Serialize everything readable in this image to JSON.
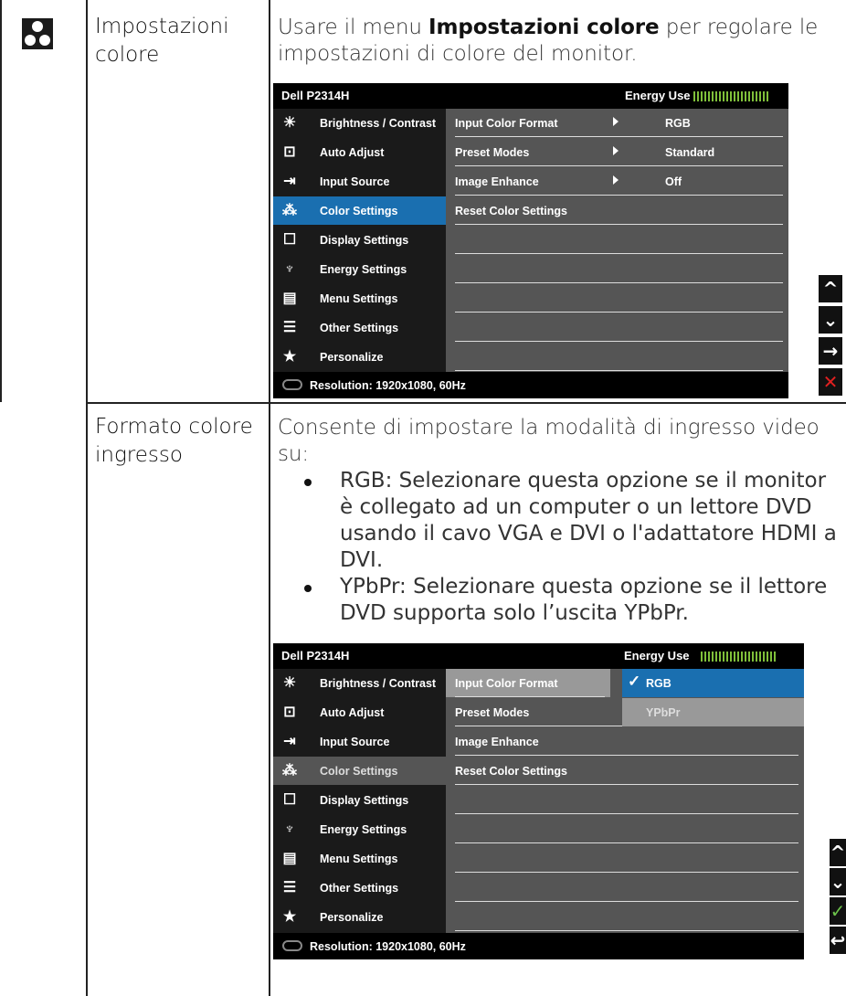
{
  "row1": {
    "title": "Impostazioni colore",
    "desc_pre": "Usare il menu ",
    "desc_bold": "Impostazioni colore",
    "desc_post": " per regolare le impostazioni di colore del monitor."
  },
  "row2": {
    "title": "Formato colore ingresso",
    "intro": "Consente di impostare la modalità di ingresso video su:",
    "bullets": [
      "RGB: Selezionare questa opzione se il monitor è collegato ad un computer o un lettore DVD usando il cavo VGA e DVI o l'adattatore HDMI a DVI.",
      "YPbPr: Selezionare questa opzione se il lettore DVD supporta solo l’uscita YPbPr."
    ]
  },
  "osd": {
    "model": "Dell P2314H",
    "energy_label": "Energy Use",
    "resolution": "Resolution: 1920x1080, 60Hz",
    "menu": [
      {
        "label": "Brightness / Contrast",
        "icon": "brightness-icon"
      },
      {
        "label": "Auto Adjust",
        "icon": "auto-adjust-icon"
      },
      {
        "label": "Input Source",
        "icon": "input-source-icon"
      },
      {
        "label": "Color Settings",
        "icon": "color-settings-icon"
      },
      {
        "label": "Display Settings",
        "icon": "display-settings-icon"
      },
      {
        "label": "Energy Settings",
        "icon": "energy-settings-icon"
      },
      {
        "label": "Menu Settings",
        "icon": "menu-settings-icon"
      },
      {
        "label": "Other Settings",
        "icon": "other-settings-icon"
      },
      {
        "label": "Personalize",
        "icon": "star-icon"
      }
    ],
    "submenu": [
      {
        "label": "Input Color Format",
        "value": "RGB"
      },
      {
        "label": "Preset Modes",
        "value": "Standard"
      },
      {
        "label": "Image Enhance",
        "value": "Off"
      },
      {
        "label": "Reset Color Settings",
        "value": ""
      }
    ],
    "options": [
      "RGB",
      "YPbPr"
    ],
    "colors": {
      "selected": "#1a6fb0",
      "energy": "#7fbf3a",
      "close": "#e02020",
      "check": "#6cc24a"
    }
  }
}
